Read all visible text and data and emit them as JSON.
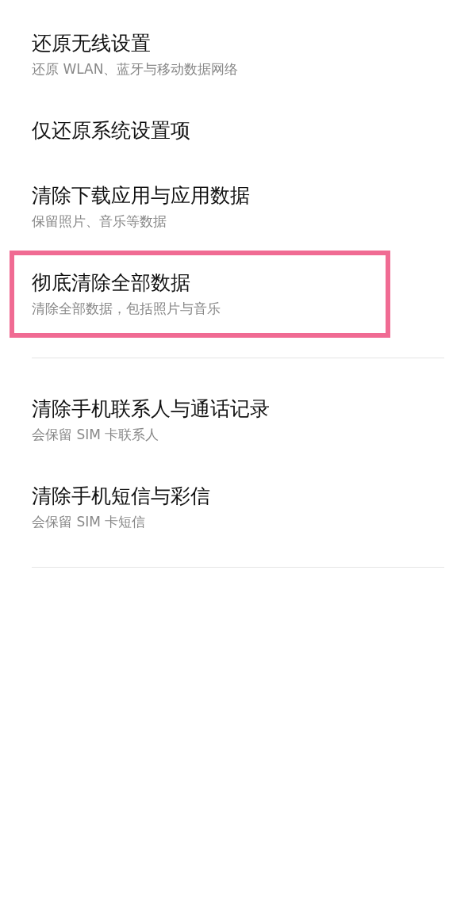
{
  "groups": [
    {
      "items": [
        {
          "title": "还原无线设置",
          "subtitle": "还原 WLAN、蓝牙与移动数据网络",
          "highlighted": false
        },
        {
          "title": "仅还原系统设置项",
          "highlighted": false
        },
        {
          "title": "清除下载应用与应用数据",
          "subtitle": "保留照片、音乐等数据",
          "highlighted": false
        },
        {
          "title": "彻底清除全部数据",
          "subtitle": "清除全部数据，包括照片与音乐",
          "highlighted": true
        }
      ]
    },
    {
      "items": [
        {
          "title": "清除手机联系人与通话记录",
          "subtitle": "会保留 SIM 卡联系人",
          "highlighted": false
        },
        {
          "title": "清除手机短信与彩信",
          "subtitle": "会保留 SIM 卡短信",
          "highlighted": false
        }
      ]
    }
  ]
}
